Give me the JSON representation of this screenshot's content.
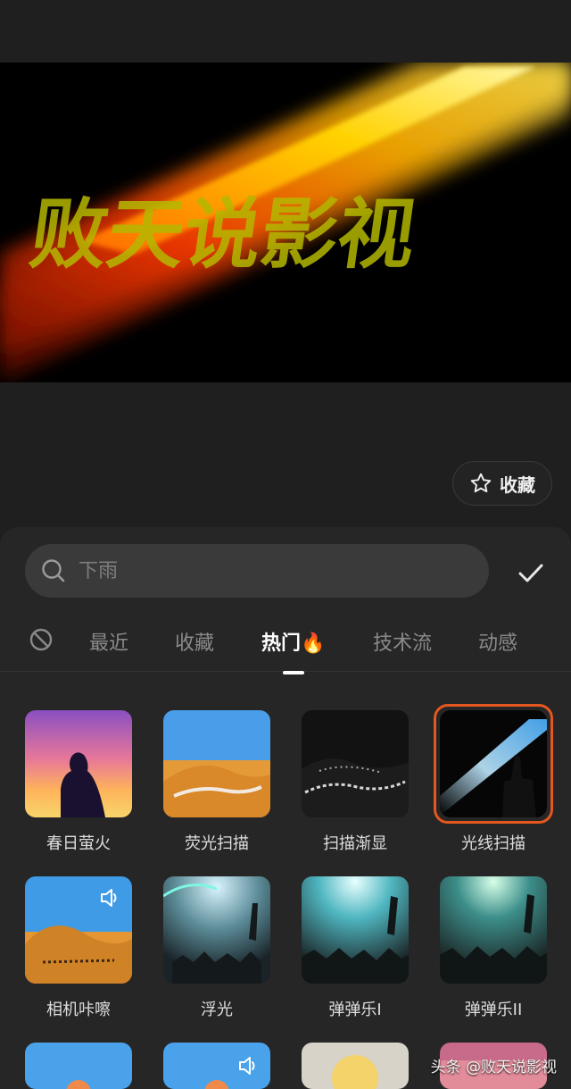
{
  "preview": {
    "overlay_text": "败天说影视"
  },
  "favorite_button": {
    "label": "收藏"
  },
  "search": {
    "placeholder": "下雨"
  },
  "tabs": [
    {
      "label": "最近",
      "active": false
    },
    {
      "label": "收藏",
      "active": false
    },
    {
      "label": "热门🔥",
      "active": true
    },
    {
      "label": "技术流",
      "active": false
    },
    {
      "label": "动感",
      "active": false
    }
  ],
  "effects": [
    {
      "label": "春日萤火",
      "selected": false,
      "sound": false
    },
    {
      "label": "荧光扫描",
      "selected": false,
      "sound": false
    },
    {
      "label": "扫描渐显",
      "selected": false,
      "sound": false
    },
    {
      "label": "光线扫描",
      "selected": true,
      "sound": false
    },
    {
      "label": "相机咔嚓",
      "selected": false,
      "sound": true
    },
    {
      "label": "浮光",
      "selected": false,
      "sound": false
    },
    {
      "label": "弹弹乐I",
      "selected": false,
      "sound": false
    },
    {
      "label": "弹弹乐II",
      "selected": false,
      "sound": false
    }
  ],
  "watermark": "头条 @败天说影视",
  "colors": {
    "accent_selected": "#e4571e",
    "background": "#1f1f1f",
    "sheet": "#262626"
  }
}
